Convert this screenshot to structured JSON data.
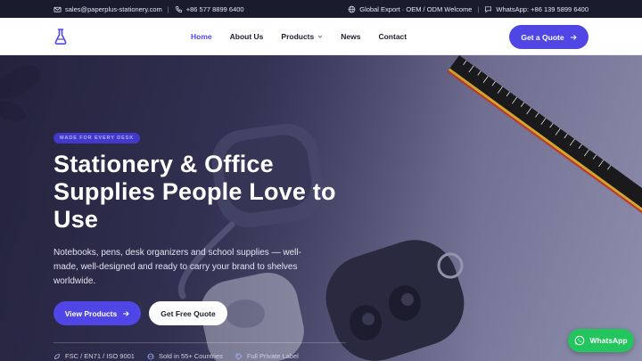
{
  "topbar": {
    "email": "sales@paperplus-stationery.com",
    "phone": "+86 577 8899 6400",
    "tagline": "Global Export · OEM / ODM Welcome",
    "whatsapp": "WhatsApp: +86 139 5899 6400",
    "separator": "|"
  },
  "header": {
    "logo_icon": "flask-icon",
    "nav": [
      {
        "label": "Home",
        "active": true
      },
      {
        "label": "About Us",
        "active": false
      },
      {
        "label": "Products",
        "active": false,
        "dropdown": true
      },
      {
        "label": "News",
        "active": false
      },
      {
        "label": "Contact",
        "active": false
      }
    ],
    "cta_label": "Get a Quote"
  },
  "hero": {
    "badge": "MADE FOR EVERY DESK",
    "title": "Stationery & Office Supplies People Love to Use",
    "description": "Notebooks, pens, desk organizers and school supplies — well-made, well-designed and ready to carry your brand to shelves worldwide.",
    "primary_button": "View Products",
    "secondary_button": "Get Free Quote",
    "features": [
      {
        "icon": "leaf-icon",
        "label": "FSC / EN71 / ISO 9001"
      },
      {
        "icon": "globe-icon",
        "label": "Sold in 55+ Countries"
      },
      {
        "icon": "tag-icon",
        "label": "Full Private Label"
      }
    ]
  },
  "whatsapp_float": {
    "label": "WhatsApp"
  },
  "colors": {
    "accent": "#4f46e5",
    "topbar_bg": "#1b1b2e",
    "whatsapp": "#22c55e"
  }
}
